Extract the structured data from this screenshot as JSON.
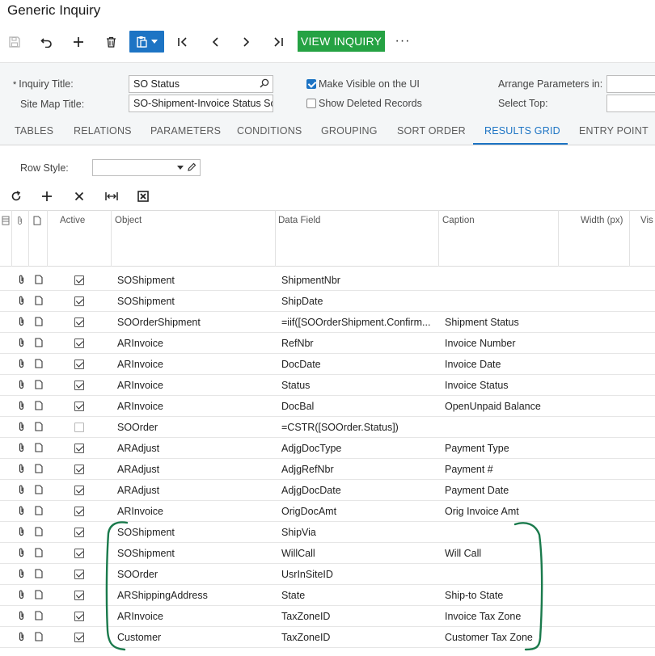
{
  "page": {
    "title": "Generic Inquiry"
  },
  "toolbar": {
    "save_icon": "save-icon",
    "undo_icon": "undo-icon",
    "add_icon": "plus-icon",
    "delete_icon": "trash-icon",
    "clipboard_icon": "clipboard-icon",
    "first_icon": "first-record-icon",
    "prev_icon": "previous-record-icon",
    "next_icon": "next-record-icon",
    "last_icon": "last-record-icon",
    "view_inquiry": "VIEW INQUIRY",
    "more": "···",
    "accent": "#1d74c4",
    "green": "#25a243"
  },
  "form": {
    "inquiry_title_label": "Inquiry Title:",
    "inquiry_title_value": "SO Status",
    "site_map_title_label": "Site Map Title:",
    "site_map_title_value": "SO-Shipment-Invoice Status Sc",
    "make_visible_label": "Make Visible on the UI",
    "show_deleted_label": "Show Deleted Records",
    "arrange_params_label": "Arrange Parameters in:",
    "select_top_label": "Select Top:"
  },
  "tabs": [
    {
      "label": "TABLES"
    },
    {
      "label": "RELATIONS"
    },
    {
      "label": "PARAMETERS"
    },
    {
      "label": "CONDITIONS"
    },
    {
      "label": "GROUPING"
    },
    {
      "label": "SORT ORDER"
    },
    {
      "label": "RESULTS GRID"
    },
    {
      "label": "ENTRY POINT"
    }
  ],
  "grid_controls": {
    "row_style_label": "Row Style:"
  },
  "grid": {
    "headers": {
      "active": "Active",
      "object": "Object",
      "data_field": "Data Field",
      "caption": "Caption",
      "width": "Width (px)",
      "visible": "Vis"
    },
    "rows": [
      {
        "active": true,
        "object": "SOShipment",
        "data_field": "ShipmentNbr",
        "caption": ""
      },
      {
        "active": true,
        "object": "SOShipment",
        "data_field": "ShipDate",
        "caption": ""
      },
      {
        "active": true,
        "object": "SOOrderShipment",
        "data_field": "=iif([SOOrderShipment.Confirm...",
        "caption": "Shipment Status"
      },
      {
        "active": true,
        "object": "ARInvoice",
        "data_field": "RefNbr",
        "caption": "Invoice Number"
      },
      {
        "active": true,
        "object": "ARInvoice",
        "data_field": "DocDate",
        "caption": "Invoice Date"
      },
      {
        "active": true,
        "object": "ARInvoice",
        "data_field": "Status",
        "caption": "Invoice Status"
      },
      {
        "active": true,
        "object": "ARInvoice",
        "data_field": "DocBal",
        "caption": "OpenUnpaid Balance"
      },
      {
        "active": false,
        "object": "SOOrder",
        "data_field": "=CSTR([SOOrder.Status])",
        "caption": ""
      },
      {
        "active": true,
        "object": "ARAdjust",
        "data_field": "AdjgDocType",
        "caption": "Payment Type"
      },
      {
        "active": true,
        "object": "ARAdjust",
        "data_field": "AdjgRefNbr",
        "caption": "Payment #"
      },
      {
        "active": true,
        "object": "ARAdjust",
        "data_field": "AdjgDocDate",
        "caption": "Payment Date"
      },
      {
        "active": true,
        "object": "ARInvoice",
        "data_field": "OrigDocAmt",
        "caption": "Orig Invoice Amt"
      },
      {
        "active": true,
        "object": "SOShipment",
        "data_field": "ShipVia",
        "caption": ""
      },
      {
        "active": true,
        "object": "SOShipment",
        "data_field": "WillCall",
        "caption": "Will Call"
      },
      {
        "active": true,
        "object": "SOOrder",
        "data_field": "UsrInSiteID",
        "caption": ""
      },
      {
        "active": true,
        "object": "ARShippingAddress",
        "data_field": "State",
        "caption": "Ship-to State"
      },
      {
        "active": true,
        "object": "ARInvoice",
        "data_field": "TaxZoneID",
        "caption": "Invoice Tax Zone"
      },
      {
        "active": true,
        "object": "Customer",
        "data_field": "TaxZoneID",
        "caption": "Customer Tax Zone"
      }
    ]
  },
  "annotation": {
    "color": "#1a7a4c"
  }
}
